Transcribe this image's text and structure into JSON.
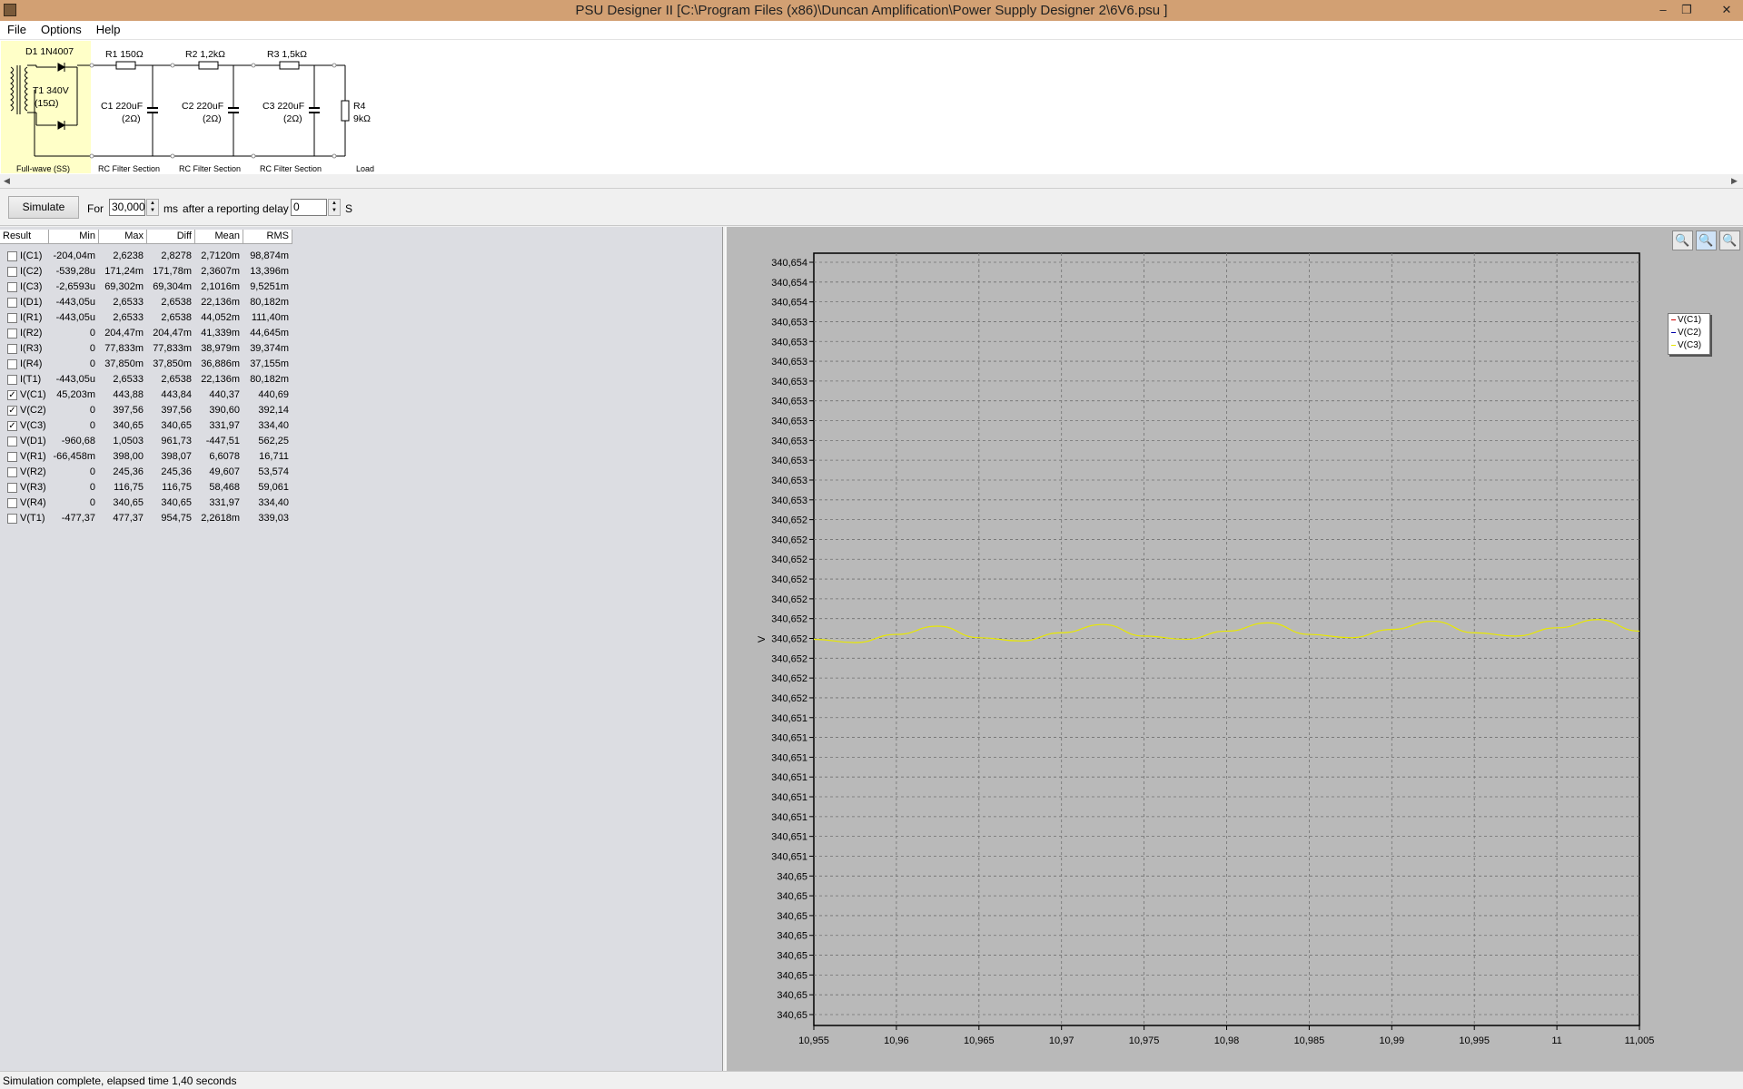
{
  "window": {
    "title": "PSU Designer II  [C:\\Program Files (x86)\\Duncan Amplification\\Power Supply Designer 2\\6V6.psu ]",
    "minimize": "–",
    "restore": "❐",
    "close": "✕"
  },
  "menu": {
    "file": "File",
    "options": "Options",
    "help": "Help"
  },
  "schematic": {
    "d1": "D1 1N4007",
    "t1_line1": "T1 340V",
    "t1_line2": "(15Ω)",
    "r1": "R1 150Ω",
    "r2": "R2 1,2kΩ",
    "r3": "R3 1,5kΩ",
    "c1_line1": "C1 220uF",
    "c1_line2": "(2Ω)",
    "c2_line1": "C2 220uF",
    "c2_line2": "(2Ω)",
    "c3_line1": "C3 220uF",
    "c3_line2": "(2Ω)",
    "r4_line1": "R4",
    "r4_line2": "9kΩ",
    "sec_fullwave": "Full-wave (SS)",
    "sec_rc1": "RC Filter Section",
    "sec_rc2": "RC Filter Section",
    "sec_rc3": "RC Filter Section",
    "sec_load": "Load"
  },
  "controls": {
    "simulate_label": "Simulate",
    "for_label": "For",
    "duration_value": "30,000",
    "ms_label": "ms",
    "delay_label": "after a reporting delay of",
    "delay_value": "0",
    "s_label": "S"
  },
  "results": {
    "headers": {
      "result": "Result",
      "min": "Min",
      "max": "Max",
      "diff": "Diff",
      "mean": "Mean",
      "rms": "RMS"
    },
    "rows": [
      {
        "name": "I(C1)",
        "checked": false,
        "min": "-204,04m",
        "max": "2,6238",
        "diff": "2,8278",
        "mean": "2,7120m",
        "rms": "98,874m"
      },
      {
        "name": "I(C2)",
        "checked": false,
        "min": "-539,28u",
        "max": "171,24m",
        "diff": "171,78m",
        "mean": "2,3607m",
        "rms": "13,396m"
      },
      {
        "name": "I(C3)",
        "checked": false,
        "min": "-2,6593u",
        "max": "69,302m",
        "diff": "69,304m",
        "mean": "2,1016m",
        "rms": "9,5251m"
      },
      {
        "name": "I(D1)",
        "checked": false,
        "min": "-443,05u",
        "max": "2,6533",
        "diff": "2,6538",
        "mean": "22,136m",
        "rms": "80,182m"
      },
      {
        "name": "I(R1)",
        "checked": false,
        "min": "-443,05u",
        "max": "2,6533",
        "diff": "2,6538",
        "mean": "44,052m",
        "rms": "111,40m"
      },
      {
        "name": "I(R2)",
        "checked": false,
        "min": "0",
        "max": "204,47m",
        "diff": "204,47m",
        "mean": "41,339m",
        "rms": "44,645m"
      },
      {
        "name": "I(R3)",
        "checked": false,
        "min": "0",
        "max": "77,833m",
        "diff": "77,833m",
        "mean": "38,979m",
        "rms": "39,374m"
      },
      {
        "name": "I(R4)",
        "checked": false,
        "min": "0",
        "max": "37,850m",
        "diff": "37,850m",
        "mean": "36,886m",
        "rms": "37,155m"
      },
      {
        "name": "I(T1)",
        "checked": false,
        "min": "-443,05u",
        "max": "2,6533",
        "diff": "2,6538",
        "mean": "22,136m",
        "rms": "80,182m"
      },
      {
        "name": "V(C1)",
        "checked": true,
        "min": "45,203m",
        "max": "443,88",
        "diff": "443,84",
        "mean": "440,37",
        "rms": "440,69"
      },
      {
        "name": "V(C2)",
        "checked": true,
        "min": "0",
        "max": "397,56",
        "diff": "397,56",
        "mean": "390,60",
        "rms": "392,14"
      },
      {
        "name": "V(C3)",
        "checked": true,
        "min": "0",
        "max": "340,65",
        "diff": "340,65",
        "mean": "331,97",
        "rms": "334,40"
      },
      {
        "name": "V(D1)",
        "checked": false,
        "min": "-960,68",
        "max": "1,0503",
        "diff": "961,73",
        "mean": "-447,51",
        "rms": "562,25"
      },
      {
        "name": "V(R1)",
        "checked": false,
        "min": "-66,458m",
        "max": "398,00",
        "diff": "398,07",
        "mean": "6,6078",
        "rms": "16,711"
      },
      {
        "name": "V(R2)",
        "checked": false,
        "min": "0",
        "max": "245,36",
        "diff": "245,36",
        "mean": "49,607",
        "rms": "53,574"
      },
      {
        "name": "V(R3)",
        "checked": false,
        "min": "0",
        "max": "116,75",
        "diff": "116,75",
        "mean": "58,468",
        "rms": "59,061"
      },
      {
        "name": "V(R4)",
        "checked": false,
        "min": "0",
        "max": "340,65",
        "diff": "340,65",
        "mean": "331,97",
        "rms": "334,40"
      },
      {
        "name": "V(T1)",
        "checked": false,
        "min": "-477,37",
        "max": "477,37",
        "diff": "954,75",
        "mean": "2,2618m",
        "rms": "339,03"
      }
    ]
  },
  "zoom": {
    "zoom_in": "🔍",
    "zoom_fit": "🔍",
    "zoom_out": "🔍"
  },
  "colors": {
    "plot_bg": "#b9b9b9",
    "trace": "#e8e800",
    "grid": "#707070"
  },
  "chart_data": {
    "type": "line",
    "ylabel": "V",
    "xlim": [
      10.955,
      11.005
    ],
    "ylim": [
      340.6496,
      340.6543
    ],
    "x_ticks": [
      "10,955",
      "10,96",
      "10,965",
      "10,97",
      "10,975",
      "10,98",
      "10,985",
      "10,99",
      "10,995",
      "11",
      "11,005"
    ],
    "y_ticks": [
      "340,654",
      "340,654",
      "340,654",
      "340,653",
      "340,653",
      "340,653",
      "340,653",
      "340,653",
      "340,653",
      "340,653",
      "340,653",
      "340,653",
      "340,653",
      "340,652",
      "340,652",
      "340,652",
      "340,652",
      "340,652",
      "340,652",
      "340,652",
      "340,652",
      "340,652",
      "340,652",
      "340,651",
      "340,651",
      "340,651",
      "340,651",
      "340,651",
      "340,651",
      "340,651",
      "340,651",
      "340,65",
      "340,65",
      "340,65",
      "340,65",
      "340,65",
      "340,65",
      "340,65",
      "340,65"
    ],
    "legend": [
      "V(C1)",
      "V(C2)",
      "V(C3)"
    ],
    "legend_position": "right",
    "grid": true,
    "series": [
      {
        "name": "V(C3)",
        "color": "#e8e800",
        "x": [
          10.955,
          10.9575,
          10.96,
          10.9625,
          10.965,
          10.9675,
          10.97,
          10.9725,
          10.975,
          10.9775,
          10.98,
          10.9825,
          10.985,
          10.9875,
          10.99,
          10.9925,
          10.995,
          10.9975,
          11.0,
          11.0025,
          11.005
        ],
        "y": [
          340.65195,
          340.65193,
          340.65198,
          340.65203,
          340.65196,
          340.65194,
          340.65199,
          340.65204,
          340.65197,
          340.65195,
          340.652,
          340.65205,
          340.65198,
          340.65196,
          340.65201,
          340.65206,
          340.65199,
          340.65197,
          340.65202,
          340.65207,
          340.652
        ]
      }
    ]
  },
  "status": {
    "text": "Simulation complete, elapsed time 1,40 seconds"
  }
}
